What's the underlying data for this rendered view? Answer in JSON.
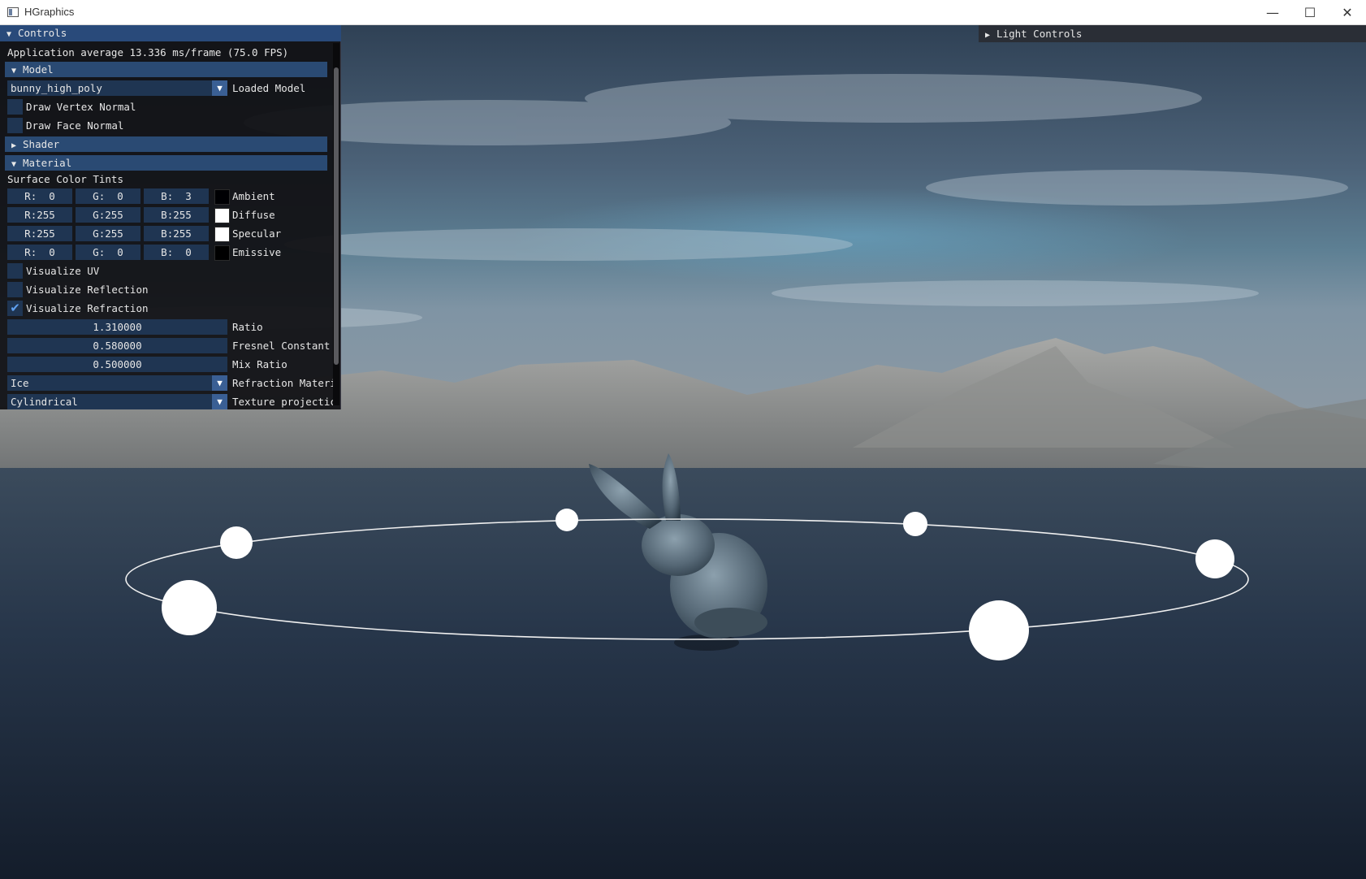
{
  "window": {
    "title": "HGraphics",
    "minimize": "—",
    "maximize": "☐",
    "close": "✕"
  },
  "controls": {
    "title": "Controls",
    "fps_text": "Application average 13.336 ms/frame (75.0 FPS)",
    "model_header": "Model",
    "model_combo_value": "bunny_high_poly",
    "model_combo_label": "Loaded Model",
    "draw_vertex_normal": "Draw Vertex Normal",
    "draw_face_normal": "Draw Face Normal",
    "shader_header": "Shader",
    "material_header": "Material",
    "surface_color_tints": "Surface Color Tints",
    "tints": [
      {
        "r": "R:  0",
        "g": "G:  0",
        "b": "B:  3",
        "label": "Ambient",
        "color": "#000003"
      },
      {
        "r": "R:255",
        "g": "G:255",
        "b": "B:255",
        "label": "Diffuse",
        "color": "#ffffff"
      },
      {
        "r": "R:255",
        "g": "G:255",
        "b": "B:255",
        "label": "Specular",
        "color": "#ffffff"
      },
      {
        "r": "R:  0",
        "g": "G:  0",
        "b": "B:  0",
        "label": "Emissive",
        "color": "#000000"
      }
    ],
    "visualize_uv": "Visualize UV",
    "visualize_reflection": "Visualize Reflection",
    "visualize_refraction": "Visualize Refraction",
    "visualize_refraction_checked": true,
    "ratio_value": "1.310000",
    "ratio_label": "Ratio",
    "fresnel_value": "0.580000",
    "fresnel_label": "Fresnel Constant",
    "mix_value": "0.500000",
    "mix_label": "Mix Ratio",
    "refraction_combo_value": "Ice",
    "refraction_combo_label": "Refraction Materi",
    "projection_combo_value": "Cylindrical",
    "projection_combo_label": "Texture projectic"
  },
  "light_controls": {
    "title": "Light Controls"
  },
  "colors": {
    "accent": "#294a7a",
    "header": "#2a4a73",
    "frame": "#1f3552",
    "check": "#5fa0f0"
  }
}
